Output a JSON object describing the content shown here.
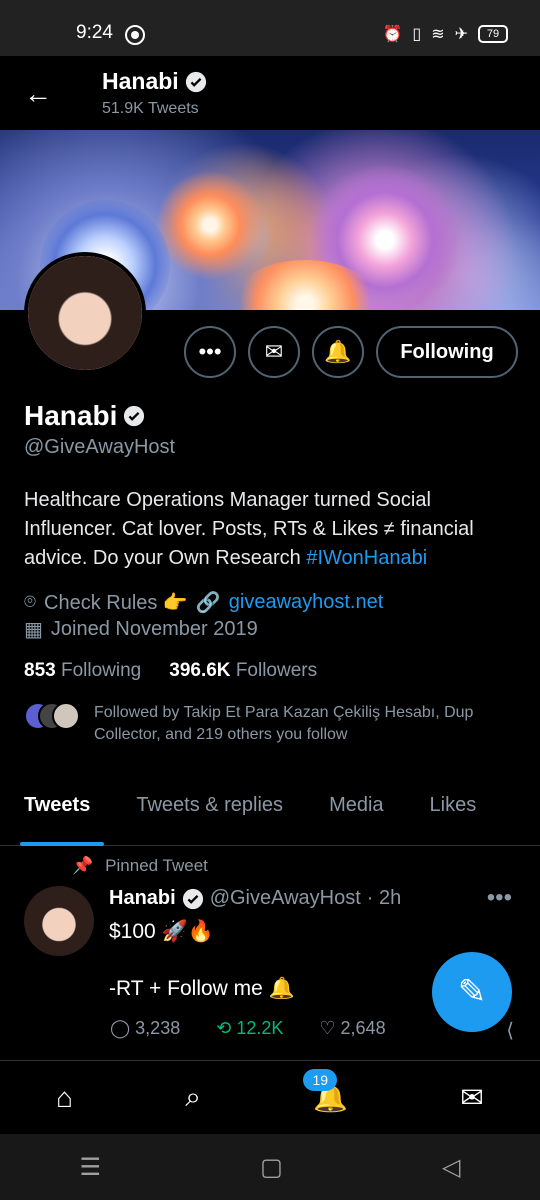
{
  "status_bar": {
    "time": "9:24",
    "battery": "79"
  },
  "header": {
    "name": "Hanabi",
    "tweets": "51.9K Tweets"
  },
  "profile": {
    "name": "Hanabi",
    "handle": "@GiveAwayHost",
    "bio_text": "Healthcare Operations Manager turned Social Influencer. Cat lover. Posts, RTs & Likes ≠ financial advice. Do your Own Research ",
    "bio_hashtag": "#IWonHanabi",
    "location": "Check Rules 👉",
    "website": "giveawayhost.net",
    "joined": "Joined November 2019",
    "following_count": "853",
    "following_label": "Following",
    "followers_count": "396.6K",
    "followers_label": "Followers",
    "followed_by": "Followed by Takip Et Para Kazan Çekiliş Hesabı, Dup Collector, and 219 others you follow",
    "follow_button": "Following"
  },
  "tabs": [
    "Tweets",
    "Tweets & replies",
    "Media",
    "Likes"
  ],
  "tweet": {
    "pinned_label": "Pinned Tweet",
    "author": "Hanabi",
    "handle": "@GiveAwayHost",
    "time": "· 2h",
    "line1": "$100 🚀🔥",
    "line2": "-RT + Follow me 🔔",
    "replies": "3,238",
    "retweets": "12.2K",
    "likes": "2,648"
  },
  "bottom_nav": {
    "notifications_badge": "19"
  },
  "colors": {
    "accent": "#1d9bf0",
    "retweet_green": "#00ba7c",
    "muted": "#8b98a5"
  }
}
